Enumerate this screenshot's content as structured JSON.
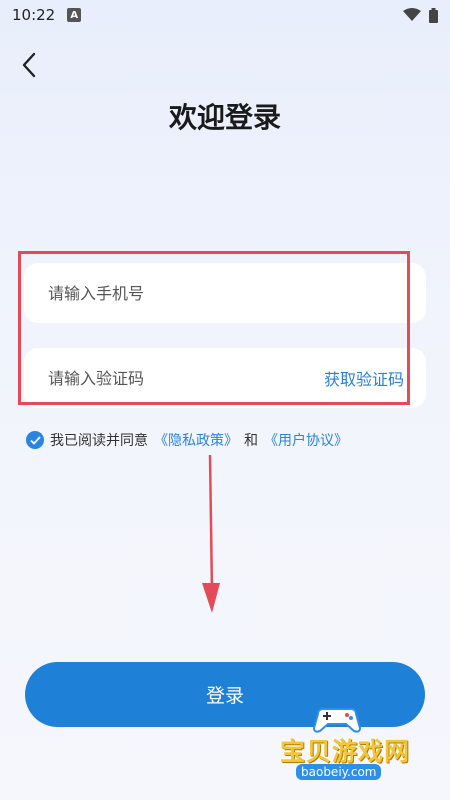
{
  "status": {
    "time": "10:22",
    "a_badge": "A"
  },
  "header": {
    "title": "欢迎登录"
  },
  "form": {
    "phone_placeholder": "请输入手机号",
    "code_placeholder": "请输入验证码",
    "get_code_label": "获取验证码"
  },
  "agreement": {
    "checked": true,
    "prefix": "我已阅读并同意",
    "privacy_link": "《隐私政策》",
    "and": "和",
    "terms_link": "《用户协议》"
  },
  "login_button": {
    "label": "登录"
  },
  "watermark": {
    "brand": "宝贝游戏网",
    "domain": "baobeiy.com"
  },
  "colors": {
    "accent": "#1f80d8",
    "link": "#2a84e0",
    "highlight": "#e34b58"
  },
  "icons": [
    "back-arrow-icon",
    "wifi-icon",
    "battery-icon",
    "check-icon",
    "down-arrow-annotation"
  ]
}
